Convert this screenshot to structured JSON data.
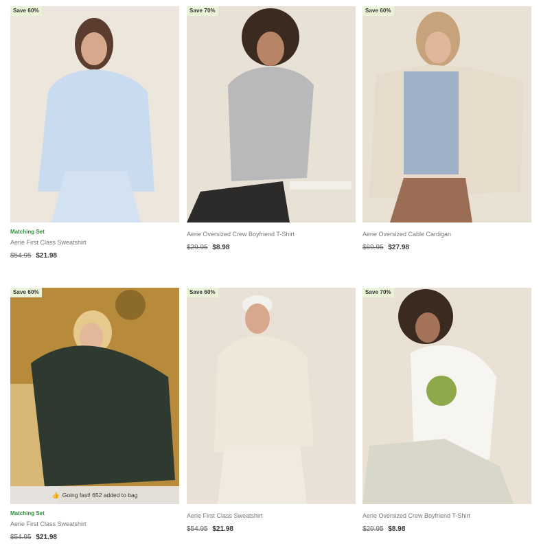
{
  "products": [
    {
      "badge": "Save 60%",
      "tag": "Matching Set",
      "name": "Aerie First Class Sweatshirt",
      "was": "$54.95",
      "now": "$21.98",
      "image_alt": "light blue sweatshirt set"
    },
    {
      "badge": "Save 70%",
      "tag": "",
      "name": "Aerie Oversized Crew Boyfriend T-Shirt",
      "was": "$29.95",
      "now": "$8.98",
      "image_alt": "gray tee"
    },
    {
      "badge": "Save 60%",
      "tag": "",
      "name": "Aerie Oversized Cable Cardigan",
      "was": "$69.95",
      "now": "$27.98",
      "image_alt": "cream cable cardigan"
    },
    {
      "badge": "Save 60%",
      "tag": "Matching Set",
      "name": "Aerie First Class Sweatshirt",
      "was": "$54.95",
      "now": "$21.98",
      "image_alt": "dark green sweatshirt",
      "flag": "Going fast! 652 added to bag"
    },
    {
      "badge": "Save 60%",
      "tag": "",
      "name": "Aerie First Class Sweatshirt",
      "was": "$54.95",
      "now": "$21.98",
      "image_alt": "cream sweatshirt"
    },
    {
      "badge": "Save 70%",
      "tag": "",
      "name": "Aerie Oversized Crew Boyfriend T-Shirt",
      "was": "$29.95",
      "now": "$8.98",
      "image_alt": "white graphic tee"
    }
  ],
  "icons": {
    "flag_icon": "thumbs-up-icon"
  },
  "colors": {
    "badge_bg": "#eaf3d8",
    "tag_green": "#2f8a3a"
  }
}
